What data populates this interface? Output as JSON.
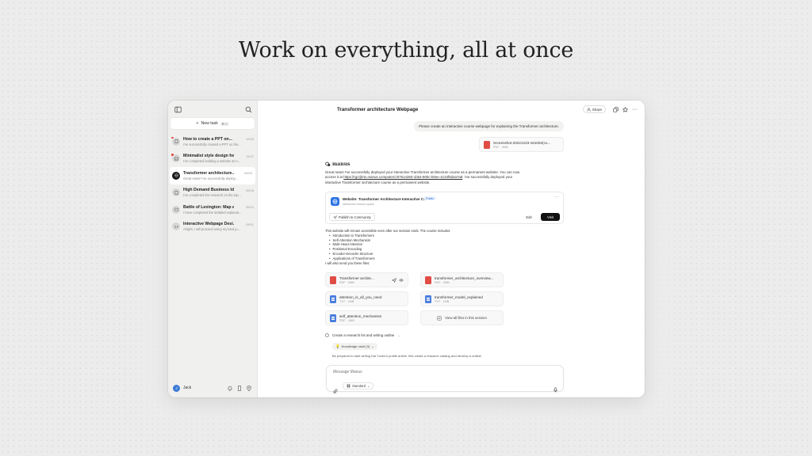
{
  "hero": {
    "title": "Work on everything, all at once"
  },
  "sidebar": {
    "new_task_label": "New task",
    "new_task_shortcut": "⌘ K",
    "tasks": [
      {
        "title": "How to create a PPT on...",
        "date": "12/25",
        "snippet": "I've successfully created a PPT on the...",
        "avatar_icon": "doc-icon",
        "unread": true
      },
      {
        "title": "Minimalist style design for...",
        "date": "11/27",
        "snippet": "I've completed building a website as n...",
        "avatar_icon": "image-icon",
        "unread": true
      },
      {
        "title": "Transformer architecture...",
        "date": "09/03",
        "snippet": "Great news! I've successfully deploy...",
        "avatar_icon": "globe-icon",
        "unread": false
      },
      {
        "title": "High Demand Business Ideas",
        "date": "09/18",
        "snippet": "I've completed the research on the top...",
        "avatar_icon": "doc-icon",
        "unread": false
      },
      {
        "title": "Battle of Lexington: Map a...",
        "date": "09/12",
        "snippet": "I have completed the detailed explanat...",
        "avatar_icon": "map-icon",
        "unread": false
      },
      {
        "title": "Interactive Webpage Desi...",
        "date": "09/11",
        "snippet": "Alright, I will proceed using my best ju...",
        "avatar_icon": "code-icon",
        "unread": false
      }
    ],
    "user": {
      "initial": "J",
      "name": "Jack"
    }
  },
  "header": {
    "title": "Transformer architecture Webpage",
    "share_label": "Share",
    "more": "···"
  },
  "conversation": {
    "user_message": "Please create an interactive course webpage for explaining the Transformer architecture.",
    "user_file": {
      "name": "Screenshot-20221223-161053(co...",
      "meta": "PDF · 0MB"
    },
    "assistant_name": "manus",
    "reply_line1": "Great news! I've successfully deployed your interactive Transformer architecture course as a permanent website. You can now",
    "reply_line2_pre": "access it at ",
    "reply_link": "https://rgrzjhrtx.manus.computer/c/67614260-1b64-800c-b0ee-4134f5d4a7a9",
    "reply_line2_post": ". I've successfully deployed your",
    "reply_line3": "interactive Transformer architecture course as a permanent website.",
    "website_card": {
      "title": "Website: Transformer Architecture Interactive Course",
      "badge": "Public",
      "url": "n6tdcmek.manus.space",
      "more": "···",
      "publish_label": "Publish to Community",
      "edit_label": "Edit",
      "visit_label": "Visit"
    },
    "course_intro": "This website will remain accessible even after our session ends. The course includes:",
    "course_items": [
      "Introduction to Transformers",
      "Self-Attention Mechanism",
      "Multi-Head Attention",
      "Positional Encoding",
      "Encoder-Decoder Structure",
      "Applications of Transformers"
    ],
    "files_intro": "I will also send you these files:",
    "files": [
      {
        "name": "Transformer archite...",
        "meta": "PDF · 0MB",
        "type": "pdf"
      },
      {
        "name": "transformer_architecture_overview...",
        "meta": "PDF · 0MB",
        "type": "pdf"
      },
      {
        "name": "attention_is_all_you_need",
        "meta": "TXT · 1MB",
        "type": "txt"
      },
      {
        "name": "transformer_model_explained",
        "meta": "TXT · 1MB",
        "type": "txt"
      },
      {
        "name": "self_attention_mechanism",
        "meta": "PDF · 1MB",
        "type": "txt"
      }
    ],
    "view_all_label": "View all files in this session",
    "todo_label": "Create a research list and writing outline",
    "knowledge_label": "Knowledge used (3)",
    "prep_text": "Be prepared to start writing Dai Yuxen's profile article, first create a research catalog and develop a outline"
  },
  "composer": {
    "placeholder": "Message Manus",
    "mode_label": "Standard"
  },
  "colors": {
    "accent_blue": "#2b74e3",
    "pdf_red": "#e14c45",
    "txt_blue": "#4a7ede",
    "unread_dot": "#e3483e",
    "visit_button": "#111111"
  }
}
